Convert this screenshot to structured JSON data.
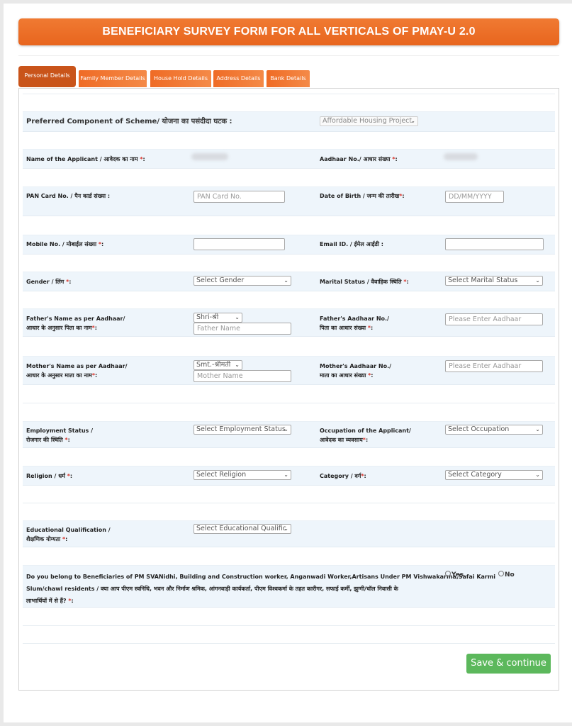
{
  "header": {
    "title": "BENEFICIARY SURVEY FORM FOR ALL VERTICALS OF PMAY-U 2.0"
  },
  "tabs": [
    {
      "label": "Personal Details",
      "active": true
    },
    {
      "label": "Family Member Details",
      "active": false
    },
    {
      "label": "House Hold Details",
      "active": false
    },
    {
      "label": "Address Details",
      "active": false
    },
    {
      "label": "Bank Details",
      "active": false
    }
  ],
  "form": {
    "component": {
      "label": "Preferred Component of Scheme/ योजना का पसंदीदा घटक :",
      "value": "Affordable Housing Project"
    },
    "applicant_name": {
      "label": "Name of the Applicant / आवेदक का नाम ",
      "required": "*",
      "suffix": ":"
    },
    "aadhaar": {
      "label": "Aadhaar No./ आधार संख्या ",
      "required": "*",
      "suffix": ":"
    },
    "pan": {
      "label": "PAN Card No. / पैन कार्ड संख्या :",
      "placeholder": "PAN Card No."
    },
    "dob": {
      "label": "Date of Birth / जन्म की तारीख",
      "required": "*",
      "suffix": ":",
      "placeholder": "DD/MM/YYYY"
    },
    "mobile": {
      "label": "Mobile No. / मोबाईल संख्या ",
      "required": "*",
      "suffix": ":",
      "value": ""
    },
    "email": {
      "label": "Email ID. / ईमेल आईडी :",
      "value": ""
    },
    "gender": {
      "label": "Gender / लिंग ",
      "required": "*",
      "suffix": ":",
      "value": "Select Gender"
    },
    "marital": {
      "label": "Marital Status / वैवाहिक स्थिति ",
      "required": "*",
      "suffix": ":",
      "value": "Select Marital Status"
    },
    "father_name": {
      "label_line1": "Father's Name as per Aadhaar/",
      "label_line2": "आधार के अनुसार पिता का नाम",
      "required": "*",
      "suffix": ":",
      "prefix_value": "Shri-श्री",
      "placeholder": "Father Name"
    },
    "father_aadhaar": {
      "label_line1": "Father's Aadhaar No./",
      "label_line2": "पिता का आधार संख्या ",
      "required": "*",
      "suffix": ":",
      "placeholder": "Please Enter Aadhaar"
    },
    "mother_name": {
      "label_line1": "Mother's Name as per Aadhaar/",
      "label_line2": "आधार के अनुसार माता का नाम",
      "required": "*",
      "suffix": ":",
      "prefix_value": "Smt.-श्रीमती",
      "placeholder": "Mother Name"
    },
    "mother_aadhaar": {
      "label_line1": "Mother's Aadhaar No./",
      "label_line2": "माता का आधार संख्या ",
      "required": "*",
      "suffix": ":",
      "placeholder": "Please Enter Aadhaar"
    },
    "employment": {
      "label_line1": "Employment Status /",
      "label_line2": "रोजगार की स्थिति ",
      "required": "*",
      "suffix": ":",
      "value": "Select Employment Status"
    },
    "occupation": {
      "label_line1": "Occupation of the Applicant/",
      "label_line2": "आवेदक का व्यवसाय",
      "required": "*",
      "suffix": ":",
      "value": "Select Occupation"
    },
    "religion": {
      "label": "Religion / धर्म ",
      "required": "*",
      "suffix": ":",
      "value": "Select Religion"
    },
    "category": {
      "label": "Category / वर्ग",
      "required": "*",
      "suffix": ":",
      "value": "Select Category"
    },
    "education": {
      "label_line1": "Educational Qualification /",
      "label_line2": "शैक्षणिक योग्यता ",
      "required": "*",
      "suffix": ":",
      "value": "Select Educational Qualific"
    },
    "pm_beneficiary": {
      "line1": "Do you belong to Beneficiaries of PM SVANidhi, Building and Construction worker, Anganwadi Worker,Artisans Under PM Vishwakarma,Safai Karmi",
      "line2": "Slum/chawl residents / क्या आप पीएम स्वनिधि, भवन और निर्माण श्रमिक, आंगनवाड़ी कार्यकर्ता, पीएम विश्वकर्मा के तहत कारीगर, सफाई कर्मी, झुग्गी/चॉल निवासी के",
      "line3": "लाभार्थियों में से हैं? ",
      "required": "*",
      "suffix": ":",
      "options": [
        "Yes",
        "No"
      ]
    }
  },
  "actions": {
    "save_label": "Save & continue"
  },
  "colors": {
    "brand_orange": "#ec6b26",
    "active_tab": "#c9541a",
    "save_green": "#5cb85c",
    "required_red": "#d9342b"
  }
}
